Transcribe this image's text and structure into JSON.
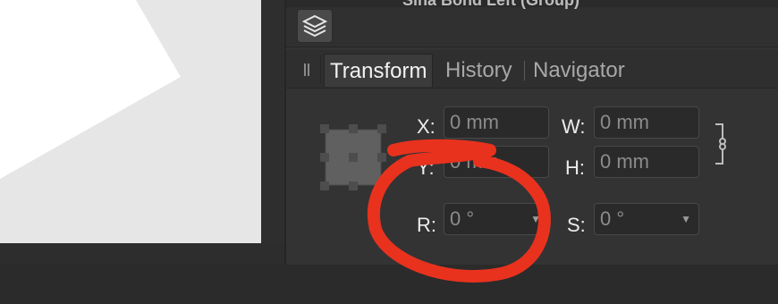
{
  "top_strip": {
    "cut_text": "Sina Bond Left (Group)"
  },
  "tabs": [
    {
      "label": "Transform",
      "active": true
    },
    {
      "label": "History",
      "active": false
    },
    {
      "label": "Navigator",
      "active": false
    }
  ],
  "transform": {
    "x": {
      "label": "X:",
      "value": "0 mm"
    },
    "y": {
      "label": "Y:",
      "value": "0 mm"
    },
    "w": {
      "label": "W:",
      "value": "0 mm"
    },
    "h": {
      "label": "H:",
      "value": "0 mm"
    },
    "r": {
      "label": "R:",
      "value": "0 °"
    },
    "s": {
      "label": "S:",
      "value": "0 °"
    }
  },
  "icons": {
    "layers": "layers-stack-icon",
    "link": "aspect-ratio-link-icon",
    "anchor": "transform-anchor-icon"
  },
  "colors": {
    "annotation": "#e8321e",
    "panel": "#333334",
    "canvas": "#e6e6e6"
  }
}
